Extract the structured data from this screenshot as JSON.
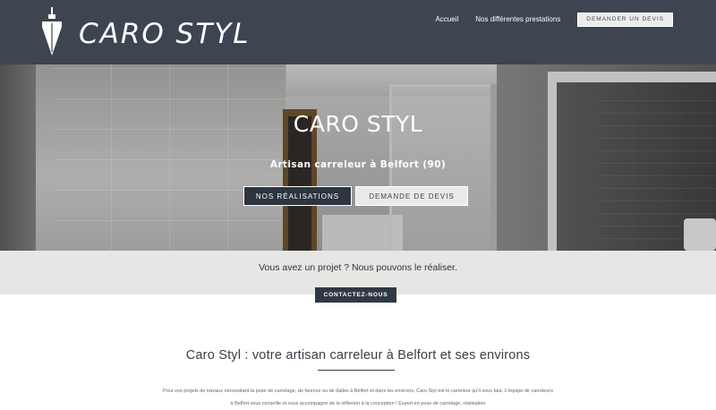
{
  "brand": {
    "name": "CARO STYL"
  },
  "nav": {
    "links": [
      "Accueil",
      "Nos différentes prestations"
    ],
    "cta": "DEMANDER UN DEVIS"
  },
  "hero": {
    "title": "CARO STYL",
    "subtitle": "Artisan carreleur à Belfort (90)",
    "primary_button": "NOS RÉALISATIONS",
    "secondary_button": "DEMANDE DE DEVIS"
  },
  "cta_band": {
    "text": "Vous avez un projet ? Nous pouvons le réaliser.",
    "button": "CONTACTEZ-NOUS"
  },
  "main": {
    "title": "Caro Styl : votre artisan carreleur à Belfort et ses environs",
    "paragraph": "Pour vos projets de travaux nécessitant la pose de carrelage, de faïence ou de dalles à Belfort et dans les environs, Caro Styl est le carreleur qu'il vous faut. L'équipe de carreleurs à Belfort vous conseille et vous accompagne de la réflexion à la conception ! Expert en pose de carrelage, réalisation"
  },
  "colors": {
    "header": "#3c4550",
    "dark_button": "#2c3540",
    "band": "#e6e6e4"
  }
}
